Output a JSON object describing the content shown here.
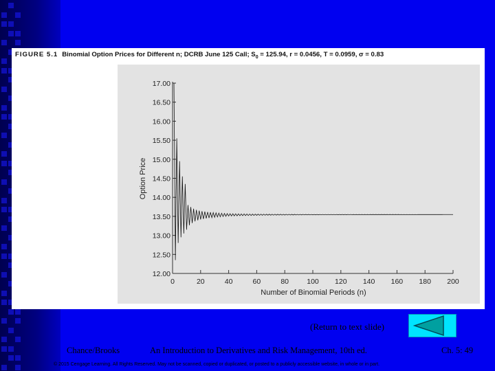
{
  "figure": {
    "number": "FIGURE 5.1",
    "title": "Binomial Option Prices for Different n; DCRB June 125 Call; S",
    "subscript": "0",
    "title_rest": " = 125.94, r = 0.0456, T = 0.0959, σ = 0.83"
  },
  "chart_data": {
    "type": "line",
    "title": "",
    "xlabel": "Number of Binomial Periods (n)",
    "ylabel": "Option Price",
    "xlim": [
      0,
      200
    ],
    "ylim": [
      12.0,
      17.0
    ],
    "x_ticks": [
      "0",
      "20",
      "40",
      "60",
      "80",
      "100",
      "120",
      "140",
      "160",
      "180",
      "200"
    ],
    "y_ticks": [
      "12.00",
      "12.50",
      "13.00",
      "13.50",
      "14.00",
      "14.50",
      "15.00",
      "15.50",
      "16.00",
      "16.50",
      "17.00"
    ],
    "series": [
      {
        "converges_to": 13.55,
        "points": [
          [
            1,
            17.0
          ],
          [
            2,
            12.35
          ],
          [
            3,
            15.55
          ],
          [
            4,
            12.8
          ],
          [
            5,
            14.95
          ],
          [
            6,
            12.95
          ],
          [
            7,
            14.55
          ],
          [
            8,
            13.05
          ],
          [
            9,
            14.35
          ],
          [
            10,
            13.15
          ],
          [
            12,
            13.2
          ],
          [
            14,
            13.25
          ],
          [
            16,
            13.3
          ],
          [
            20,
            13.35
          ],
          [
            30,
            13.42
          ],
          [
            40,
            13.47
          ],
          [
            60,
            13.5
          ],
          [
            100,
            13.53
          ],
          [
            200,
            13.55
          ]
        ]
      }
    ],
    "grid": false,
    "colors": {
      "line": "#111111",
      "plot_background": "#e3e3e3"
    }
  },
  "navigation": {
    "return_label": "(Return to text slide)"
  },
  "footer": {
    "authors": "Chance/Brooks",
    "book": "An Introduction to Derivatives and Risk Management, 10th ed.",
    "page": "Ch. 5: 49",
    "copyright": "© 2015 Cengage Learning. All Rights Reserved. May not be scanned, copied or duplicated, or posted to a publicly accessible website, in whole or in part."
  },
  "colors": {
    "slide_background": "#0000f0",
    "button_fill": "#00e4ff",
    "arrow_fill": "#00a0a0"
  },
  "icons": {
    "return_button": "left-triangle-arrow-icon"
  }
}
